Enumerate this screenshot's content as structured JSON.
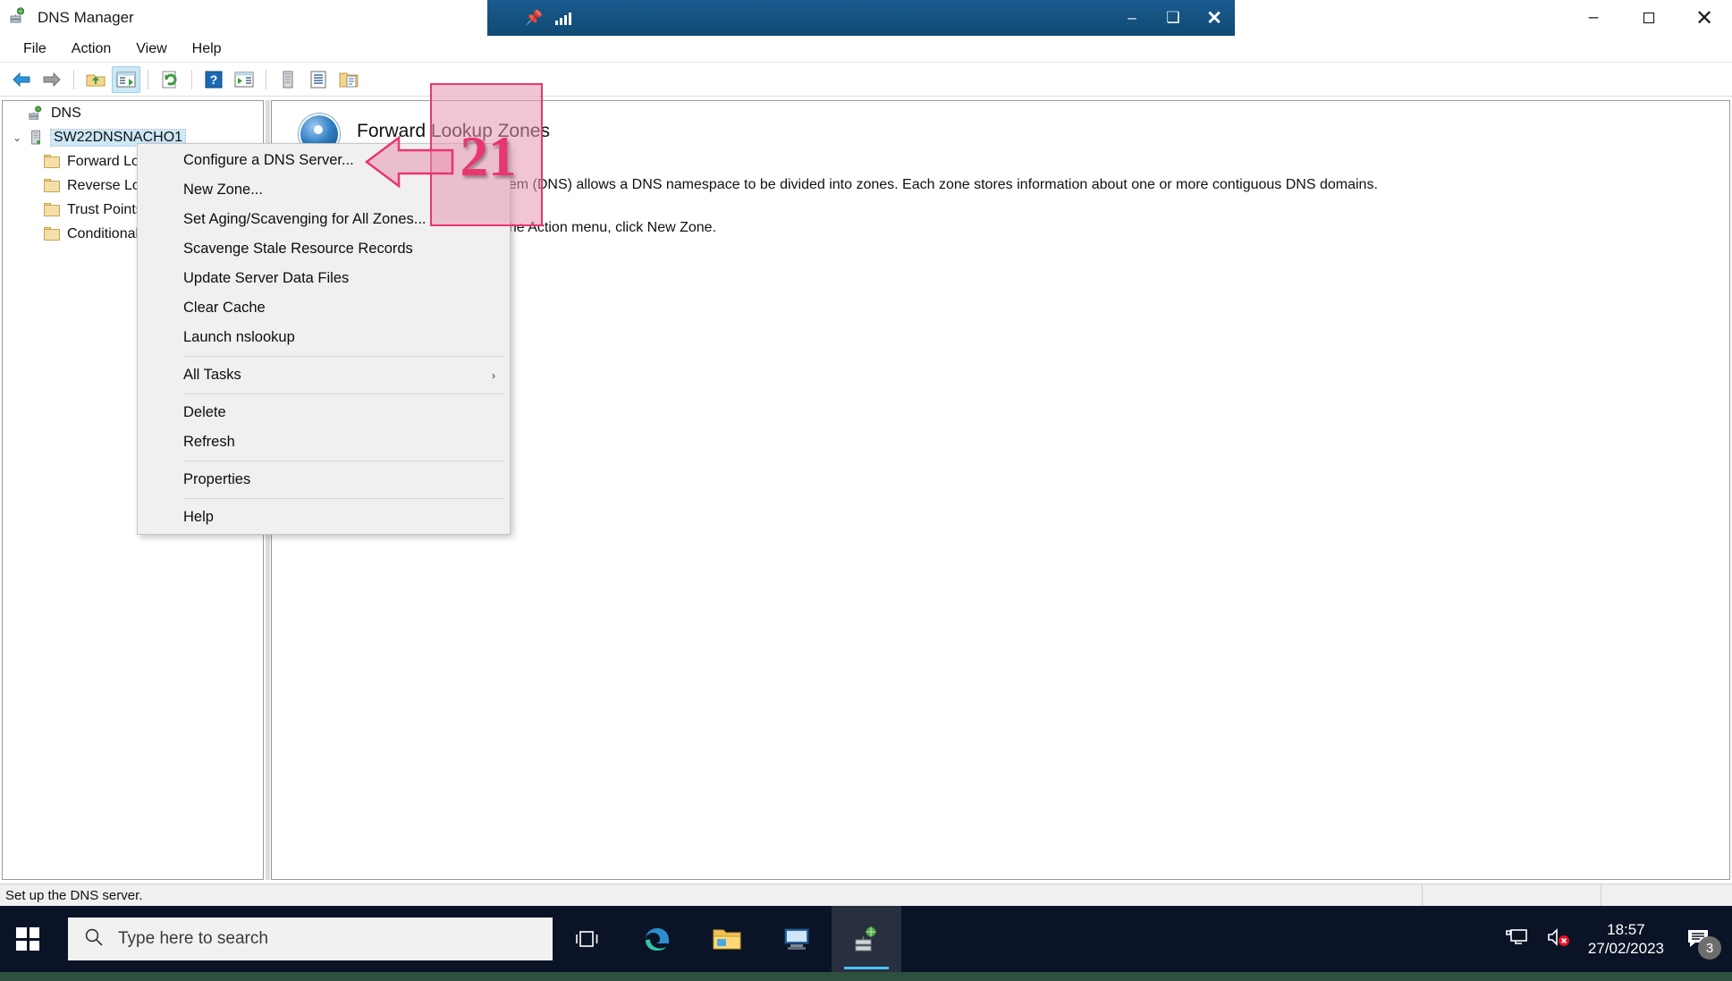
{
  "window": {
    "app_title": "DNS Manager",
    "app_icon": "dns-server-icon",
    "minimize_label": "–",
    "maximize_label": "❐",
    "close_label": "✕"
  },
  "rdp_bar": {
    "pin_icon": "pin-icon",
    "signal_icon": "signal-bars-icon",
    "title": "",
    "minimize_label": "–",
    "maximize_label": "❑",
    "close_label": "✕"
  },
  "menubar": {
    "items": [
      {
        "label": "File",
        "name": "menu-file"
      },
      {
        "label": "Action",
        "name": "menu-action"
      },
      {
        "label": "View",
        "name": "menu-view"
      },
      {
        "label": "Help",
        "name": "menu-help"
      }
    ]
  },
  "toolbar": {
    "buttons": [
      {
        "name": "back-button",
        "icon": "back-arrow-icon"
      },
      {
        "name": "forward-button",
        "icon": "forward-arrow-icon"
      },
      {
        "name": "up-one-level-button",
        "icon": "up-folder-icon"
      },
      {
        "name": "show-hide-tree-button",
        "icon": "console-tree-icon"
      },
      {
        "name": "refresh-button",
        "icon": "refresh-icon"
      },
      {
        "name": "help-button",
        "icon": "help-icon"
      },
      {
        "name": "properties-button",
        "icon": "properties-icon"
      },
      {
        "name": "new-server-button",
        "icon": "server-icon"
      },
      {
        "name": "list-button",
        "icon": "list-icon"
      },
      {
        "name": "new-zone-button",
        "icon": "new-zone-icon"
      }
    ]
  },
  "tree": {
    "nodes": [
      {
        "label": "DNS",
        "level": 1,
        "icon": "dns-root-icon",
        "expander": "",
        "selected": false,
        "name": "tree-node-dns"
      },
      {
        "label": "SW22DNSNACHO1",
        "level": 1,
        "icon": "server-icon",
        "expander": "⌄",
        "selected": true,
        "name": "tree-node-server"
      },
      {
        "label": "Forward Lookup Zones",
        "level": 2,
        "icon": "folder-icon",
        "expander": "",
        "selected": false,
        "name": "tree-node-forward-lookup-zones"
      },
      {
        "label": "Reverse Lookup Zones",
        "level": 2,
        "icon": "folder-icon",
        "expander": "",
        "selected": false,
        "name": "tree-node-reverse-lookup-zones"
      },
      {
        "label": "Trust Points",
        "level": 2,
        "icon": "folder-icon",
        "expander": "",
        "selected": false,
        "name": "tree-node-trust-points"
      },
      {
        "label": "Conditional Forwarders",
        "level": 2,
        "icon": "folder-icon",
        "expander": "",
        "selected": false,
        "name": "tree-node-conditional-forwarders"
      }
    ]
  },
  "detail": {
    "icon": "dns-globe-icon",
    "heading": "Forward Lookup Zones",
    "paragraph1": "The Domain Name System (DNS) allows a DNS namespace to be divided into zones. Each zone stores information about one or more contiguous DNS domains.",
    "paragraph2": "To add a new zone, on the Action menu, click New Zone."
  },
  "context_menu": {
    "items": [
      {
        "label": "Configure a DNS Server...",
        "mnemonic": "C",
        "name": "ctx-configure-a-dns-server",
        "separator_after": false,
        "submenu": false
      },
      {
        "label": "New Zone...",
        "mnemonic": "Z",
        "name": "ctx-new-zone",
        "separator_after": false,
        "submenu": false
      },
      {
        "label": "Set Aging/Scavenging for All Zones...",
        "mnemonic": "S",
        "name": "ctx-set-aging-scavenging",
        "separator_after": false,
        "submenu": false
      },
      {
        "label": "Scavenge Stale Resource Records",
        "mnemonic": "n",
        "name": "ctx-scavenge-stale-resource-records",
        "separator_after": false,
        "submenu": false
      },
      {
        "label": "Update Server Data Files",
        "mnemonic": "U",
        "name": "ctx-update-server-data-files",
        "separator_after": false,
        "submenu": false
      },
      {
        "label": "Clear Cache",
        "mnemonic": "e",
        "name": "ctx-clear-cache",
        "separator_after": false,
        "submenu": false
      },
      {
        "label": "Launch nslookup",
        "mnemonic": "a",
        "name": "ctx-launch-nslookup",
        "separator_after": true,
        "submenu": false
      },
      {
        "label": "All Tasks",
        "mnemonic": "k",
        "name": "ctx-all-tasks",
        "separator_after": true,
        "submenu": true,
        "arrow": "›"
      },
      {
        "label": "Delete",
        "mnemonic": "D",
        "name": "ctx-delete",
        "separator_after": false,
        "submenu": false
      },
      {
        "label": "Refresh",
        "mnemonic": "f",
        "name": "ctx-refresh",
        "separator_after": true,
        "submenu": false
      },
      {
        "label": "Properties",
        "mnemonic": "e",
        "name": "ctx-properties",
        "separator_after": true,
        "submenu": false
      },
      {
        "label": "Help",
        "mnemonic": "H",
        "name": "ctx-help",
        "separator_after": false,
        "submenu": false
      }
    ]
  },
  "annotation": {
    "number": "21",
    "color": "#e8376f",
    "fill": "rgba(232,150,178,0.55)",
    "points_to": "Configure a DNS Server..."
  },
  "statusbar": {
    "text": "Set up the DNS server."
  },
  "taskbar": {
    "start_icon": "windows-logo-icon",
    "search_icon": "search-icon",
    "search_placeholder": "Type here to search",
    "icons": [
      {
        "name": "task-view-icon",
        "label": "task-view"
      },
      {
        "name": "edge-icon",
        "label": "microsoft-edge"
      },
      {
        "name": "file-explorer-icon",
        "label": "file-explorer"
      },
      {
        "name": "server-manager-icon",
        "label": "server-manager"
      },
      {
        "name": "dns-manager-icon",
        "label": "dns-manager",
        "active": true
      }
    ],
    "tray": {
      "network_icon": "network-icon",
      "volume_icon": "volume-muted-icon",
      "time": "18:57",
      "date": "27/02/2023",
      "notifications_icon": "notifications-icon",
      "notifications_count": "3"
    }
  }
}
